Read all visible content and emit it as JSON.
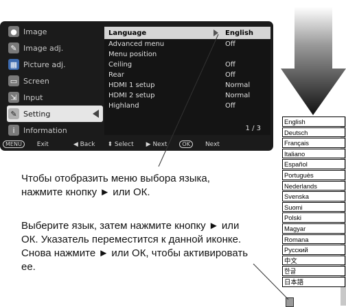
{
  "osd": {
    "left_menu": [
      {
        "label": "Image",
        "icon": "image-icon",
        "color": "#7a7a7a"
      },
      {
        "label": "Image adj.",
        "icon": "image-adjust-icon",
        "color": "#7a7a7a"
      },
      {
        "label": "Picture adj.",
        "icon": "picture-adjust-icon",
        "color": "#3d6bb0"
      },
      {
        "label": "Screen",
        "icon": "screen-icon",
        "color": "#7a7a7a"
      },
      {
        "label": "Input",
        "icon": "input-icon",
        "color": "#7a7a7a"
      },
      {
        "label": "Setting",
        "icon": "setting-icon",
        "color": "#b0b0b0",
        "selected": true
      },
      {
        "label": "Information",
        "icon": "information-icon",
        "color": "#7a7a7a"
      }
    ],
    "settings": [
      {
        "label": "Language",
        "value": "English"
      },
      {
        "label": "Advanced menu",
        "value": "Off"
      },
      {
        "label": "Menu position",
        "value": ""
      },
      {
        "label": "Ceiling",
        "value": "Off"
      },
      {
        "label": "Rear",
        "value": "Off"
      },
      {
        "label": "HDMI 1 setup",
        "value": "Normal"
      },
      {
        "label": "HDMI 2 setup",
        "value": "Normal"
      },
      {
        "label": "Highland",
        "value": "Off"
      }
    ],
    "page": "1 / 3",
    "footer": {
      "menu_chip": "MENU",
      "exit": "Exit",
      "back": "◀ Back",
      "select": "⬍ Select",
      "next": "▶ Next",
      "ok_chip": "OK",
      "ok_next": "Next"
    }
  },
  "languages": [
    "English",
    "Deutsch",
    "Français",
    "Italiano",
    "Español",
    "Portuguès",
    "Nederlands",
    "Svenska",
    "Suomi",
    "Polski",
    "Magyar",
    "Romana",
    "Русский",
    "中文",
    "한글",
    "日本語"
  ],
  "text": {
    "p1": "Чтобы отобразить меню выбора языка, нажмите кнопку ► или ОК.",
    "p2": "Выберите язык, затем нажмите кнопку ► или ОК. Указатель переместится к данной иконке. Снова нажмите ► или ОК, чтобы активировать ее."
  }
}
